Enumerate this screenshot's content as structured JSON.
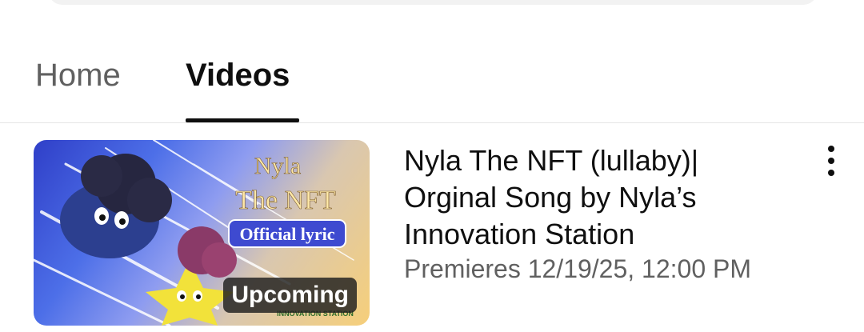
{
  "tabs": [
    {
      "label": "Home",
      "selected": false
    },
    {
      "label": "Videos",
      "selected": true
    }
  ],
  "video": {
    "thumbnail_text": {
      "line1": "Nyla",
      "line2": "The NFT",
      "line3": "Official lyric",
      "logo_text": "INNOVATION STATION"
    },
    "badge": "Upcoming",
    "title": "Nyla The NFT (lullaby)| Orginal Song by Nyla’s Innovation Station",
    "meta": "Premieres 12/19/25, 12:00 PM",
    "more_icon": "vertical-ellipsis-icon"
  },
  "colors": {
    "text_primary": "#0f0f0f",
    "text_secondary": "#606060",
    "badge_bg": "#1e1e1e"
  }
}
